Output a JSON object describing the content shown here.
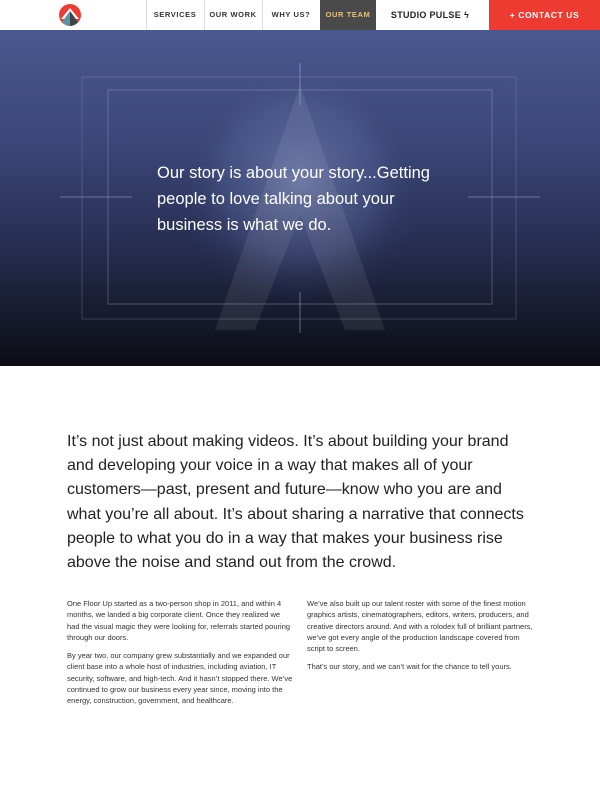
{
  "nav": {
    "items": [
      {
        "label": "SERVICES"
      },
      {
        "label": "OUR WORK"
      },
      {
        "label": "WHY US?"
      },
      {
        "label": "OUR TEAM"
      }
    ],
    "studio_pulse": "STUDIO PULSE",
    "contact": "+ CONTACT US",
    "active_color": "#e6c178",
    "accent": "#ee3b32"
  },
  "hero": {
    "headline": "Our story is about your story...Getting people to love talking about your business is what we do."
  },
  "intro": {
    "text": "It’s not just about making videos. It’s about building your brand and developing your voice in a way that makes all of your customers—past, present and future—know who you are and what you’re all about. It’s about sharing a narrative that connects people to what you do in a way that makes your business rise above the noise and stand out from the crowd."
  },
  "columns": {
    "left": [
      "One Floor Up started as a two-person shop in 2011, and within 4 months, we landed a big corporate client. Once they realized we had the visual magic they were looking for, referrals started pouring through our doors.",
      "By year two, our company grew substantially and we expanded our client base into a whole host of industries, including aviation, IT security, software, and high-tech. And it hasn’t stopped there. We’ve continued to grow our business every year since, moving into the energy, construction, government, and healthcare."
    ],
    "right": [
      "We’ve also built up our talent roster with some of the finest motion graphics artists, cinematographers, editors, writers, producers, and creative directors around. And with a rolodex full of brilliant partners, we’ve got every angle of the production landscape covered from script to screen.",
      "That’s our story, and we can’t wait for the chance to tell yours."
    ]
  }
}
